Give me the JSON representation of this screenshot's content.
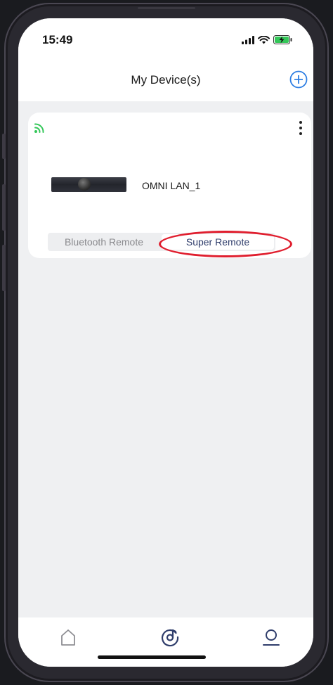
{
  "status_bar": {
    "time": "15:49",
    "icons": [
      "signal-icon",
      "wifi-icon",
      "battery-charging-icon"
    ]
  },
  "header": {
    "title": "My Device(s)",
    "add_icon": "plus-circle-icon"
  },
  "device": {
    "name": "OMNI LAN_1",
    "connection_icon": "wifi-connected-icon",
    "connection_color": "#34c759",
    "menu_icon": "more-vertical-icon"
  },
  "remote_toggle": {
    "options": [
      "Bluetooth Remote",
      "Super Remote"
    ],
    "selected": "Super Remote"
  },
  "annotation": {
    "highlight_color": "#e01e2e"
  },
  "tab_bar": {
    "items": [
      "home-icon",
      "music-disc-icon",
      "user-icon"
    ],
    "active_color": "#2f3d6b"
  }
}
